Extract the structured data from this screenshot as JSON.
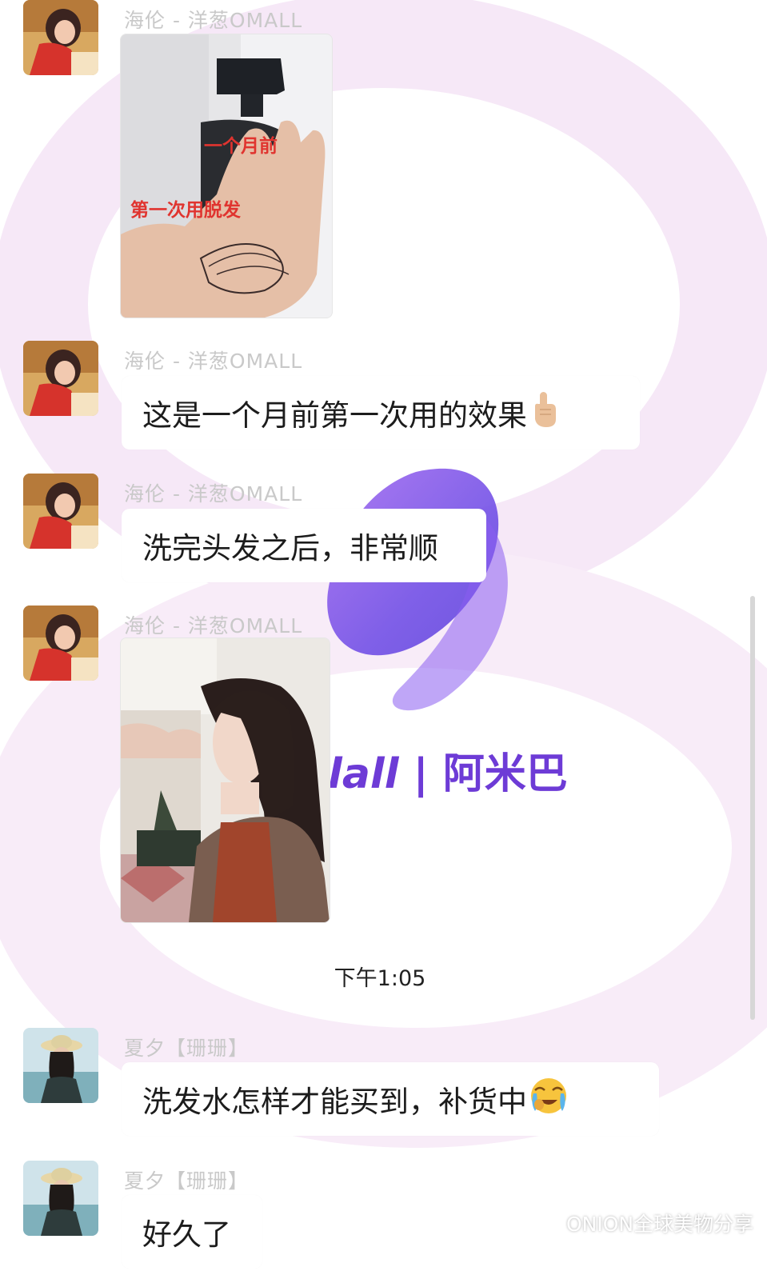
{
  "messages": [
    {
      "sender": "海伦 - 洋葱OMALL",
      "type": "image",
      "image_caption_top": "一个月前",
      "image_caption_bottom": "第一次用脱发"
    },
    {
      "sender": "海伦 - 洋葱OMALL",
      "type": "text",
      "text": "这是一个月前第一次用的效果",
      "emoji": "pointing-up-emoji"
    },
    {
      "sender": "海伦 - 洋葱OMALL",
      "type": "text",
      "text": "洗完头发之后，非常顺"
    },
    {
      "sender": "海伦 - 洋葱OMALL",
      "type": "image"
    },
    {
      "sender": "夏夕【珊珊】",
      "type": "text",
      "text": "洗发水怎样才能买到，补货中",
      "emoji": "crying-face-emoji"
    },
    {
      "sender": "夏夕【珊珊】",
      "type": "text",
      "text": "好久了"
    }
  ],
  "timestamp": "下午1:05",
  "background_brand": {
    "logo_text": "lall",
    "name": "阿米巴"
  },
  "watermark": {
    "text": "ONION全球美物分享",
    "icon": "wechat-icon"
  },
  "colors": {
    "accent_purple": "#7a4ee8",
    "caption_red": "#e0342f",
    "sender_gray": "#c9c9c9"
  }
}
